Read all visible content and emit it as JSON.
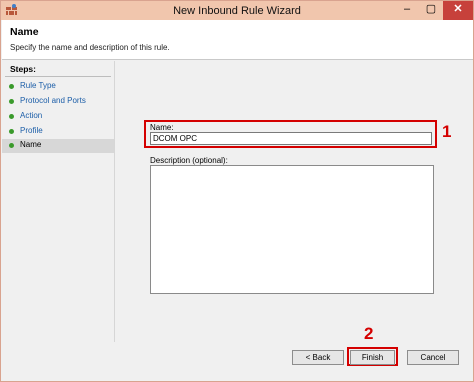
{
  "window": {
    "title": "New Inbound Rule Wizard",
    "controls": {
      "minimize": "–",
      "restore": "▢",
      "close": "✕"
    }
  },
  "header": {
    "title": "Name",
    "description": "Specify the name and description of this rule."
  },
  "steps": {
    "title": "Steps:",
    "items": [
      {
        "label": "Rule Type"
      },
      {
        "label": "Protocol and Ports"
      },
      {
        "label": "Action"
      },
      {
        "label": "Profile"
      },
      {
        "label": "Name",
        "current": true
      }
    ]
  },
  "form": {
    "name_label": "Name:",
    "name_value": "DCOM OPC",
    "description_label": "Description (optional):",
    "description_value": ""
  },
  "annotations": {
    "marker1": "1",
    "marker2": "2",
    "color": "#d40000"
  },
  "buttons": {
    "back": "< Back",
    "finish": "Finish",
    "cancel": "Cancel"
  }
}
